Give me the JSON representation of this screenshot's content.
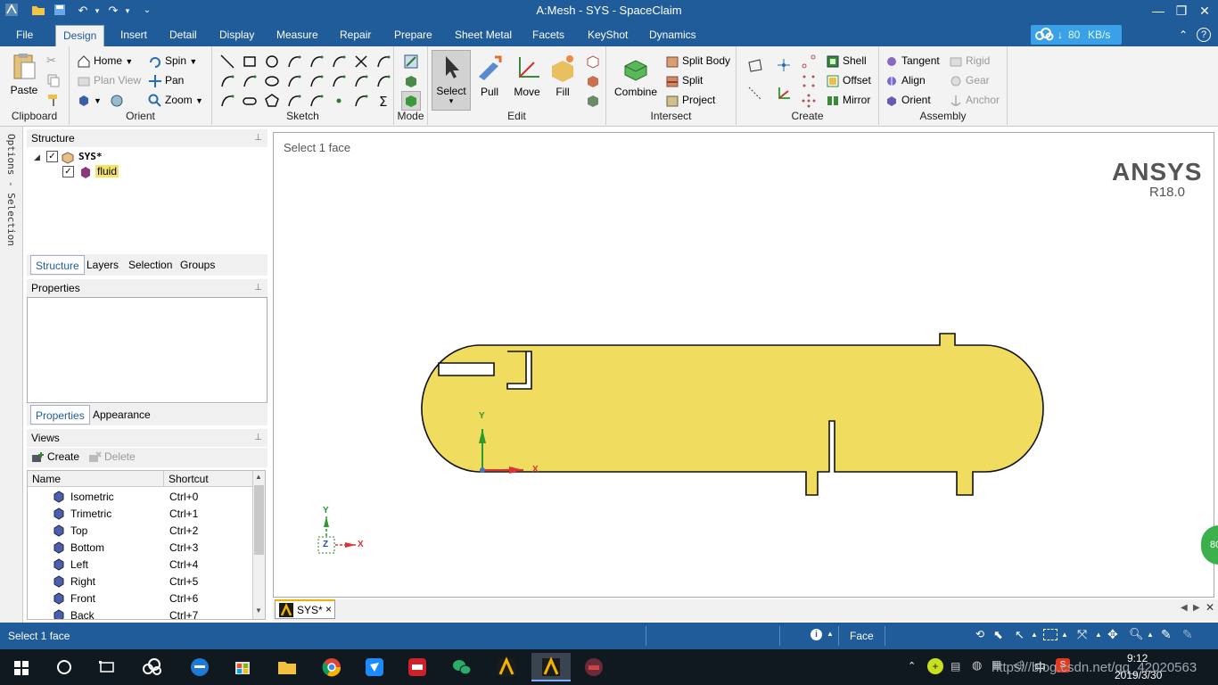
{
  "app": {
    "title": "A:Mesh - SYS - SpaceClaim"
  },
  "title_bar": {
    "minimize": "—",
    "maximize": "❐",
    "close": "✕"
  },
  "menu": {
    "file": "File",
    "tabs": [
      "Design",
      "Insert",
      "Detail",
      "Display",
      "Measure",
      "Repair",
      "Prepare",
      "Sheet Metal",
      "Facets",
      "KeyShot",
      "Dynamics"
    ],
    "active_tab": "Design",
    "net_speed": "80",
    "net_unit": "KB/s",
    "collapse": "⌃",
    "help": "?"
  },
  "ribbon": {
    "clipboard": {
      "label": "Clipboard",
      "paste": "Paste"
    },
    "orient": {
      "label": "Orient",
      "home": "Home",
      "spin": "Spin",
      "plan_view": "Plan View",
      "pan": "Pan",
      "zoom": "Zoom"
    },
    "sketch": {
      "label": "Sketch"
    },
    "mode": {
      "label": "Mode"
    },
    "edit": {
      "label": "Edit",
      "select": "Select",
      "pull": "Pull",
      "move": "Move",
      "fill": "Fill"
    },
    "intersect": {
      "label": "Intersect",
      "combine": "Combine",
      "split_body": "Split Body",
      "split": "Split",
      "project": "Project"
    },
    "create": {
      "label": "Create",
      "shell": "Shell",
      "offset": "Offset",
      "mirror": "Mirror"
    },
    "assembly": {
      "label": "Assembly",
      "tangent": "Tangent",
      "align": "Align",
      "orient": "Orient",
      "rigid": "Rigid",
      "gear": "Gear",
      "anchor": "Anchor"
    }
  },
  "left_strip": {
    "label": "Options - Selection"
  },
  "structure": {
    "header": "Structure",
    "root": "SYS*",
    "child": "fluid",
    "tabs": [
      "Structure",
      "Layers",
      "Selection",
      "Groups"
    ]
  },
  "properties": {
    "header": "Properties",
    "tabs": [
      "Properties",
      "Appearance"
    ]
  },
  "views": {
    "header": "Views",
    "create": "Create",
    "delete": "Delete",
    "col_name": "Name",
    "col_shortcut": "Shortcut",
    "rows": [
      {
        "name": "Isometric",
        "shortcut": "Ctrl+0"
      },
      {
        "name": "Trimetric",
        "shortcut": "Ctrl+1"
      },
      {
        "name": "Top",
        "shortcut": "Ctrl+2"
      },
      {
        "name": "Bottom",
        "shortcut": "Ctrl+3"
      },
      {
        "name": "Left",
        "shortcut": "Ctrl+4"
      },
      {
        "name": "Right",
        "shortcut": "Ctrl+5"
      },
      {
        "name": "Front",
        "shortcut": "Ctrl+6"
      },
      {
        "name": "Back",
        "shortcut": "Ctrl+7"
      }
    ]
  },
  "viewport": {
    "hint": "Select 1 face",
    "brand": "ANSYS",
    "version": "R18.0",
    "axis_y": "Y",
    "axis_x": "X",
    "axis_z": "Z",
    "side_badge": "80",
    "face_color": "#f0dd60"
  },
  "doc_tab": {
    "label": "SYS*",
    "close": "×"
  },
  "status": {
    "message": "Select 1 face",
    "mode": "Face"
  },
  "taskbar": {
    "time": "9:12",
    "date": "2019/3/30",
    "ime": "中",
    "watermark": "https://blog.csdn.net/qq_42020563"
  }
}
